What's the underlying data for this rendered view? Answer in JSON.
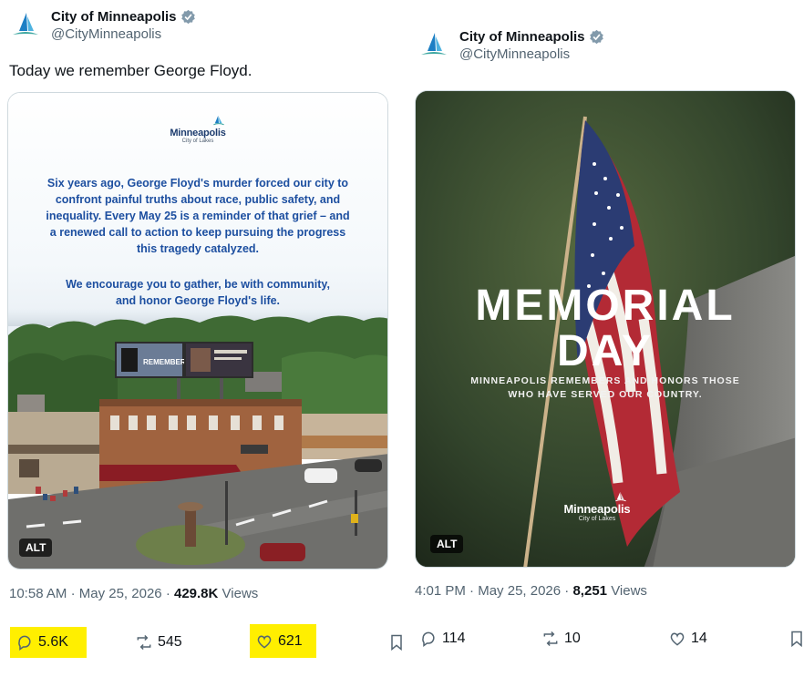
{
  "left_tweet": {
    "display_name": "City of Minneapolis",
    "handle": "@CityMinneapolis",
    "text": "Today we remember George Floyd.",
    "media": {
      "logo_word": "Minneapolis",
      "logo_sub": "City of Lakes",
      "paragraph1": "Six years ago, George Floyd's murder forced our city to confront painful truths about race, public safety, and inequality. Every May 25 is a reminder of that grief – and a renewed call to action to keep pursuing the progress this tragedy catalyzed.",
      "paragraph2": "We encourage you to gather, be with community, and honor George Floyd's life.",
      "billboard_text": "REMEMBER",
      "alt": "ALT"
    },
    "time": "10:58 AM",
    "date": "May 25, 2026",
    "views_count": "429.8K",
    "views_label": "Views",
    "replies": "5.6K",
    "reposts": "545",
    "likes": "621"
  },
  "right_tweet": {
    "display_name": "City of Minneapolis",
    "handle": "@CityMinneapolis",
    "media": {
      "title_line1": "MEMORIAL",
      "title_line2": "DAY",
      "subtitle_line1": "MINNEAPOLIS REMEMBERS AND HONORS THOSE",
      "subtitle_line2": "WHO HAVE SERVED OUR COUNTRY.",
      "logo_word": "Minneapolis",
      "logo_sub": "City of Lakes",
      "alt": "ALT"
    },
    "time": "4:01 PM",
    "date": "May 25, 2026",
    "views_count": "8,251",
    "views_label": "Views",
    "replies": "114",
    "reposts": "10",
    "likes": "14"
  },
  "colors": {
    "verified": "#829aab",
    "highlight": "#ffef00",
    "poster_blue": "#1d4fa0"
  },
  "icons": [
    "avatar-logo-icon",
    "verified-badge-icon",
    "reply-icon",
    "repost-icon",
    "like-icon",
    "bookmark-icon"
  ]
}
